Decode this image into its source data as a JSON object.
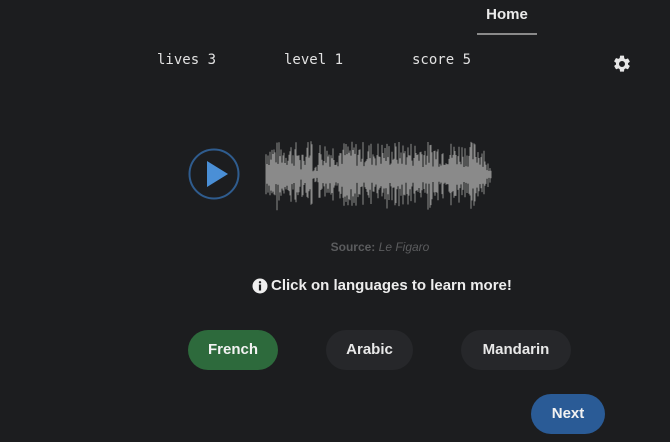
{
  "nav": {
    "home_label": "Home"
  },
  "stats": {
    "lives_label": "lives",
    "lives_value": "3",
    "level_label": "level",
    "level_value": "1",
    "score_label": "score",
    "score_value": "5"
  },
  "player": {
    "source_label": "Source:",
    "source_name": "Le Figaro"
  },
  "info": {
    "text": "Click on languages to learn more!"
  },
  "languages": [
    {
      "label": "French",
      "selected": true
    },
    {
      "label": "Arabic",
      "selected": false
    },
    {
      "label": "Mandarin",
      "selected": false
    }
  ],
  "actions": {
    "next_label": "Next"
  },
  "colors": {
    "background": "#1c1d1f",
    "selected_language": "#2d6a3c",
    "next_button": "#2a5b96",
    "play_icon": "#4a8fd6"
  },
  "icons": {
    "settings": "gear-icon",
    "play": "play-icon",
    "info": "info-icon"
  }
}
